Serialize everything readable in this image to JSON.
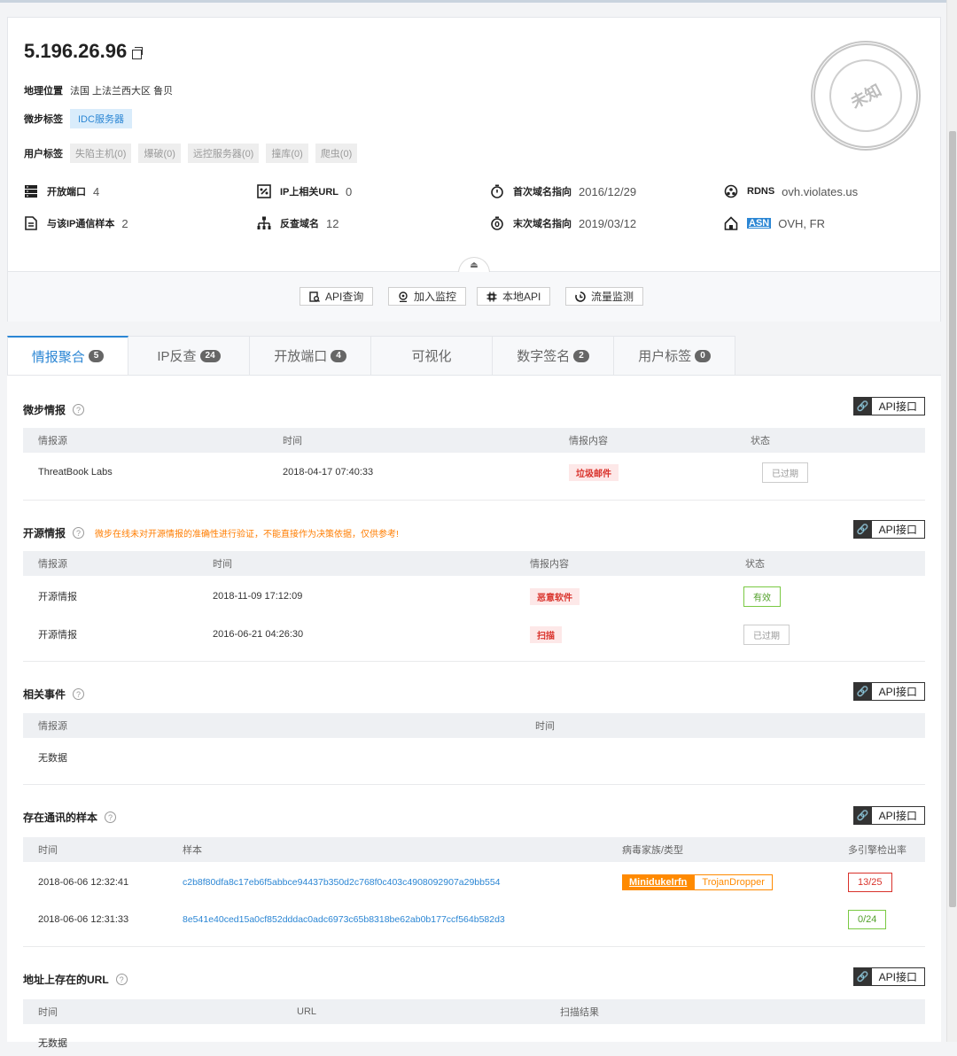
{
  "header": {
    "ip": "5.196.26.96",
    "geo_label": "地理位置",
    "geo_value": "法国 上法兰西大区 鲁贝",
    "wb_tag_label": "微步标签",
    "wb_tag": "IDC服务器",
    "user_tag_label": "用户标签",
    "user_tags": [
      "失陷主机(0)",
      "爆破(0)",
      "远控服务器(0)",
      "撞库(0)",
      "爬虫(0)"
    ],
    "stamp_text": "未知"
  },
  "stats": {
    "open_ports_label": "开放端口",
    "open_ports": "4",
    "ip_url_label": "IP上相关URL",
    "ip_url": "0",
    "first_seen_label": "首次域名指向",
    "first_seen": "2016/12/29",
    "rdns_label": "RDNS",
    "rdns": "ovh.violates.us",
    "samples_label": "与该IP通信样本",
    "samples": "2",
    "reverse_label": "反查域名",
    "reverse": "12",
    "last_seen_label": "末次域名指向",
    "last_seen": "2019/03/12",
    "asn_label": "ASN",
    "asn": "OVH, FR"
  },
  "actions": {
    "api_query": "API查询",
    "add_monitor": "加入监控",
    "local_api": "本地API",
    "traffic": "流量监测"
  },
  "tabs": [
    {
      "label": "情报聚合",
      "count": "5"
    },
    {
      "label": "IP反查",
      "count": "24"
    },
    {
      "label": "开放端口",
      "count": "4"
    },
    {
      "label": "可视化",
      "count": ""
    },
    {
      "label": "数字签名",
      "count": "2"
    },
    {
      "label": "用户标签",
      "count": "0"
    }
  ],
  "api_btn": "API接口",
  "wb_intel": {
    "title": "微步情报",
    "headers": [
      "情报源",
      "时间",
      "情报内容",
      "状态"
    ],
    "rows": [
      {
        "source": "ThreatBook Labs",
        "time": "2018-04-17 07:40:33",
        "content": "垃圾邮件",
        "status": "已过期"
      }
    ]
  },
  "os_intel": {
    "title": "开源情报",
    "warning": "微步在线未对开源情报的准确性进行验证，不能直接作为决策依据，仅供参考!",
    "headers": [
      "情报源",
      "时间",
      "情报内容",
      "状态"
    ],
    "rows": [
      {
        "source": "开源情报",
        "time": "2018-11-09 17:12:09",
        "content": "恶意软件",
        "status": "有效"
      },
      {
        "source": "开源情报",
        "time": "2016-06-21 04:26:30",
        "content": "扫描",
        "status": "已过期"
      }
    ]
  },
  "events": {
    "title": "相关事件",
    "headers": [
      "情报源",
      "时间"
    ],
    "empty": "无数据"
  },
  "samples_sec": {
    "title": "存在通讯的样本",
    "headers": [
      "时间",
      "样本",
      "病毒家族/类型",
      "多引擎检出率"
    ],
    "rows": [
      {
        "time": "2018-06-06 12:32:41",
        "hash": "c2b8f80dfa8c17eb6f5abbce94437b350d2c768f0c403c4908092907a29bb554",
        "family": "MinidukeIrfn",
        "type": "TrojanDropper",
        "rate": "13/25"
      },
      {
        "time": "2018-06-06 12:31:33",
        "hash": "8e541e40ced15a0cf852dddac0adc6973c65b8318be62ab0b177ccf564b582d3",
        "family": "",
        "type": "",
        "rate": "0/24"
      }
    ]
  },
  "urls_sec": {
    "title": "地址上存在的URL",
    "headers": [
      "时间",
      "URL",
      "扫描结果"
    ],
    "empty": "无数据"
  }
}
